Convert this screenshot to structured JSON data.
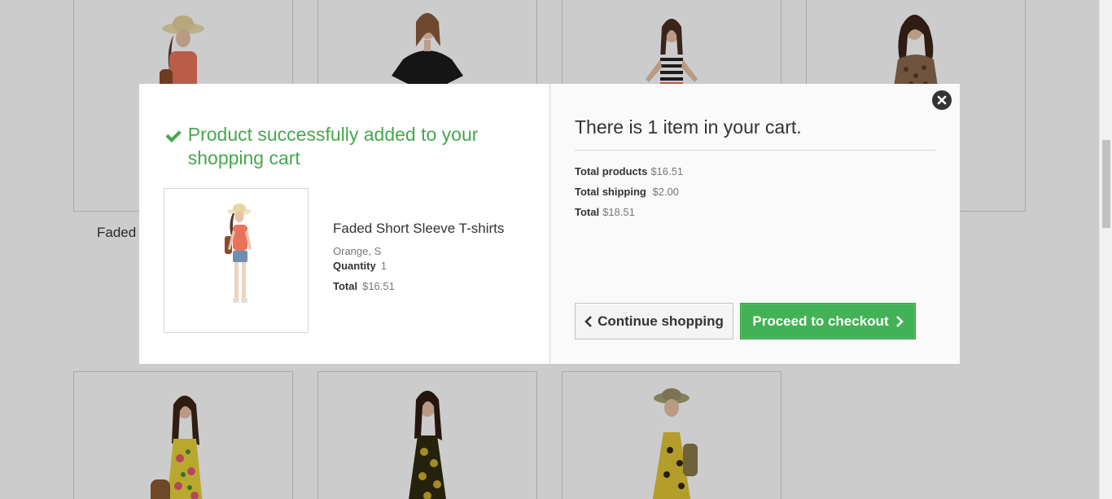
{
  "background": {
    "partial_product_label": "Faded"
  },
  "modal": {
    "success_message": "Product successfully added to your shopping cart",
    "product": {
      "name": "Faded Short Sleeve T-shirts",
      "attributes": "Orange, S",
      "quantity_label": "Quantity",
      "quantity_value": "1",
      "total_label": "Total",
      "total_value": "$16.51"
    },
    "cart": {
      "count_text": "There is 1 item in your cart.",
      "total_products_label": "Total products",
      "total_products_value": "$16.51",
      "total_shipping_label": "Total shipping",
      "total_shipping_value": "$2.00",
      "total_label": "Total",
      "total_value": "$18.51"
    },
    "buttons": {
      "continue_label": "Continue shopping",
      "checkout_label": "Proceed to checkout"
    }
  },
  "colors": {
    "success_green": "#46a74e",
    "checkout_green": "#43b155",
    "overlay": "rgba(0,0,0,0.2)"
  },
  "icons": {
    "success": "check-icon",
    "close": "close-icon",
    "continue": "chevron-left-icon",
    "checkout": "chevron-right-icon"
  }
}
